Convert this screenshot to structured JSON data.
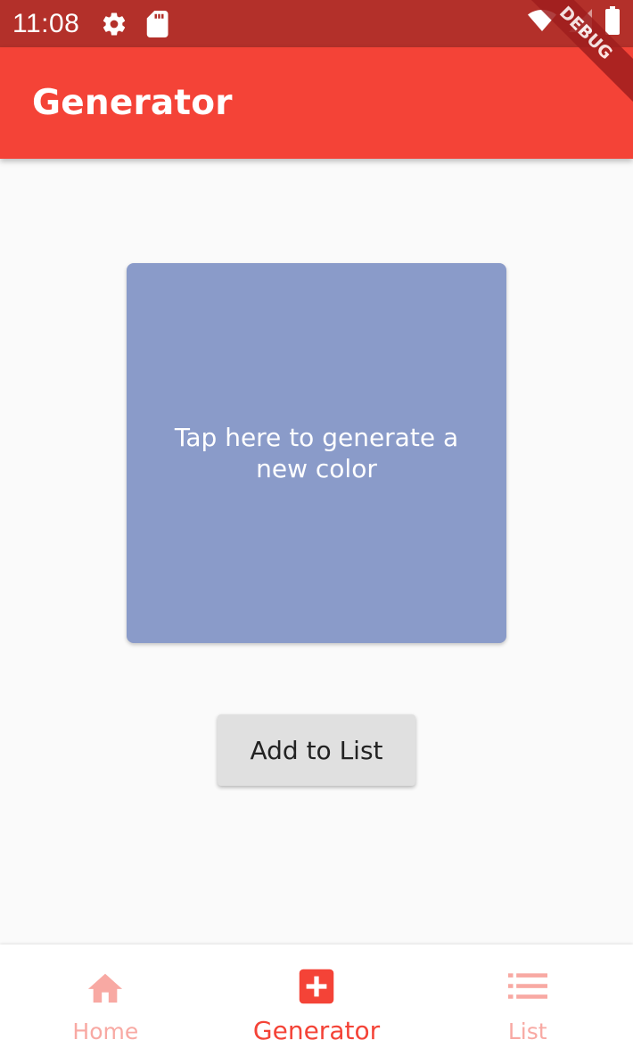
{
  "status_bar": {
    "time": "11:08"
  },
  "debug_banner": "DEBUG",
  "app_bar": {
    "title": "Generator"
  },
  "color_card": {
    "text": "Tap here to generate a new color",
    "color": "#8a9bc9"
  },
  "add_button": {
    "label": "Add to List"
  },
  "bottom_nav": {
    "active_color": "#f44337",
    "inactive_color": "#f8a9a3",
    "items": [
      {
        "label": "Home",
        "icon": "home-icon",
        "active": false
      },
      {
        "label": "Generator",
        "icon": "add-box-icon",
        "active": true
      },
      {
        "label": "List",
        "icon": "list-icon",
        "active": false
      }
    ]
  }
}
